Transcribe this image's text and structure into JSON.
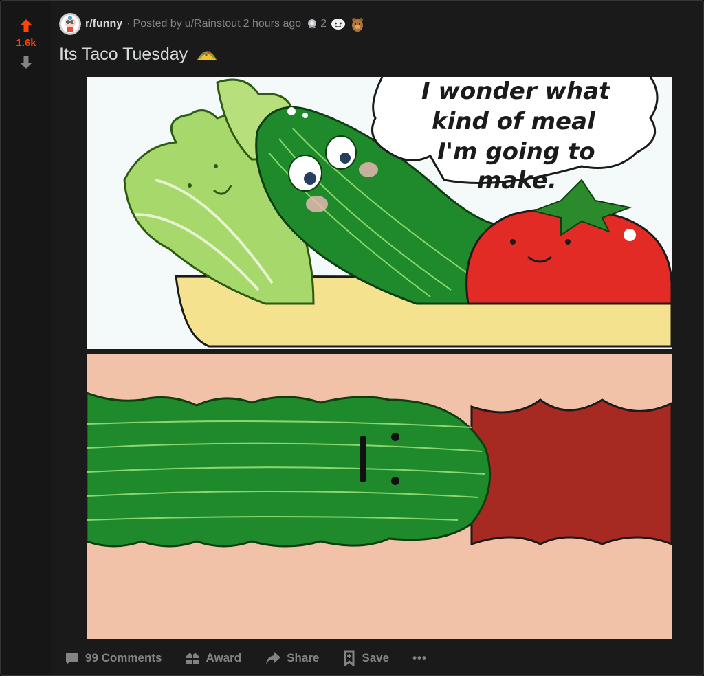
{
  "post": {
    "score": "1.6k",
    "subreddit": "r/funny",
    "separator": "·",
    "posted_by": "Posted by",
    "author": "u/Rainstout",
    "time": "2 hours ago",
    "award_count": "2",
    "title": "Its Taco Tuesday"
  },
  "comic": {
    "speech": [
      "I wonder what",
      "kind of meal",
      "I'm going to",
      "make."
    ]
  },
  "actions": {
    "comments": "99 Comments",
    "award": "Award",
    "share": "Share",
    "save": "Save",
    "more": "•••"
  },
  "colors": {
    "upvote_active": "#ff4500",
    "text_muted": "#818384",
    "text_primary": "#d7dadc",
    "card_bg": "#1a1a1b"
  },
  "icons": {
    "upvote": "arrow-up-icon",
    "downvote": "arrow-down-icon",
    "comments": "speech-bubble-icon",
    "award": "gift-icon",
    "share": "share-arrow-icon",
    "save": "bookmark-icon",
    "more": "ellipsis-icon"
  }
}
